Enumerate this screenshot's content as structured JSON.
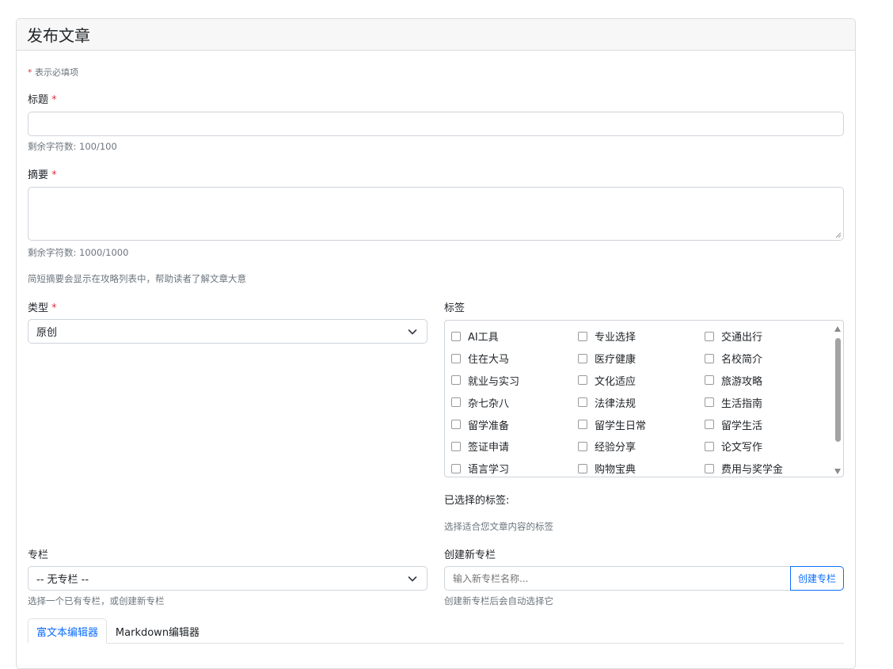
{
  "page": {
    "title": "发布文章"
  },
  "form": {
    "required_note": "表示必填项",
    "required_mark": "*",
    "title": {
      "label": "标题",
      "value": "",
      "counter": "剩余字符数: 100/100"
    },
    "summary": {
      "label": "摘要",
      "value": "",
      "counter": "剩余字符数: 1000/1000",
      "help": "简短摘要会显示在攻略列表中，帮助读者了解文章大意"
    },
    "type": {
      "label": "类型",
      "selected": "原创"
    },
    "tags": {
      "label": "标签",
      "items": [
        {
          "label": "AI工具",
          "checked": false
        },
        {
          "label": "专业选择",
          "checked": false
        },
        {
          "label": "交通出行",
          "checked": false
        },
        {
          "label": "住在大马",
          "checked": false
        },
        {
          "label": "医疗健康",
          "checked": false
        },
        {
          "label": "名校简介",
          "checked": false
        },
        {
          "label": "就业与实习",
          "checked": false
        },
        {
          "label": "文化适应",
          "checked": false
        },
        {
          "label": "旅游攻略",
          "checked": false
        },
        {
          "label": "杂七杂八",
          "checked": false
        },
        {
          "label": "法律法规",
          "checked": false
        },
        {
          "label": "生活指南",
          "checked": false
        },
        {
          "label": "留学准备",
          "checked": false
        },
        {
          "label": "留学生日常",
          "checked": false
        },
        {
          "label": "留学生活",
          "checked": false
        },
        {
          "label": "签证申请",
          "checked": false
        },
        {
          "label": "经验分享",
          "checked": false
        },
        {
          "label": "论文写作",
          "checked": false
        },
        {
          "label": "语言学习",
          "checked": false
        },
        {
          "label": "购物宝典",
          "checked": false
        },
        {
          "label": "费用与奖学金",
          "checked": false
        }
      ],
      "selected_label": "已选择的标签:",
      "help": "选择适合您文章内容的标签"
    },
    "column": {
      "label": "专栏",
      "selected": "-- 无专栏 --",
      "help": "选择一个已有专栏，或创建新专栏"
    },
    "new_column": {
      "label": "创建新专栏",
      "placeholder": "输入新专栏名称...",
      "button": "创建专栏",
      "help": "创建新专栏后会自动选择它"
    },
    "editor_tabs": [
      {
        "label": "富文本编辑器",
        "active": true
      },
      {
        "label": "Markdown编辑器",
        "active": false
      }
    ]
  }
}
